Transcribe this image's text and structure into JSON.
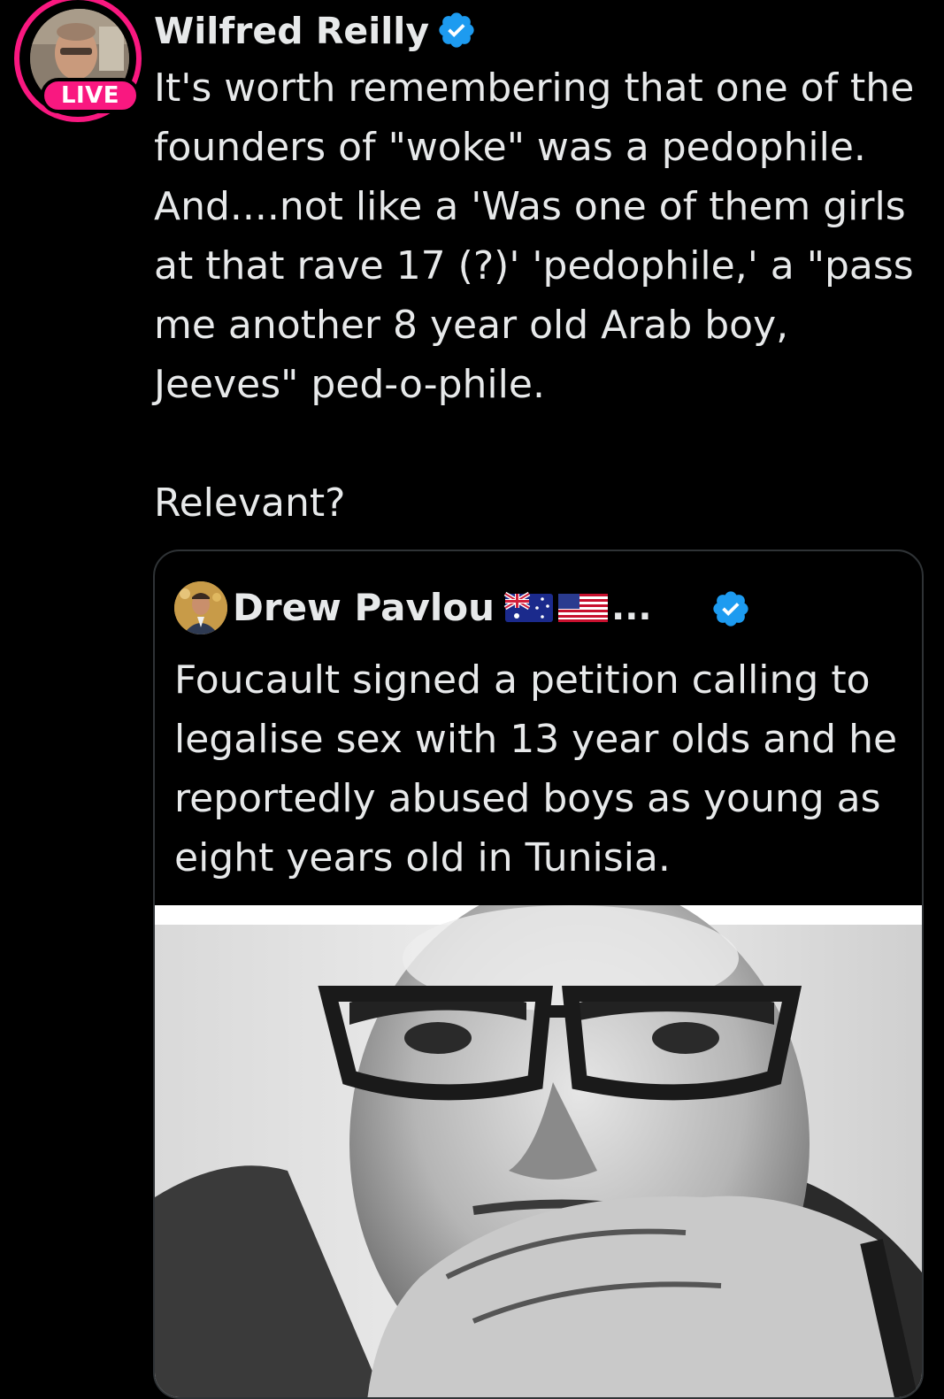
{
  "author": {
    "name": "Wilfred Reilly",
    "live_badge": "LIVE",
    "verified": true,
    "verified_color": "#1d9bf0",
    "live_ring_color": "#f91880"
  },
  "tweet": {
    "lines": [
      "It's worth remembering that one of the",
      "founders of \"woke\" was a pedophile.",
      "And....not like a 'Was one of them girls",
      "at that rave 17 (?)' 'pedophile,' a \"pass",
      "me another 8 year old Arab boy,",
      "Jeeves\" ped-o-phile."
    ],
    "closing_line": "Relevant?"
  },
  "quote": {
    "author_name": "Drew Pavlou",
    "flags": [
      "australia-flag-icon",
      "usa-flag-icon"
    ],
    "name_truncation": "...",
    "verified": true,
    "lines": [
      "Foucault signed a petition calling to",
      "legalise sex with 13 year olds and he",
      "reportedly abused boys as young as",
      "eight years old in Tunisia."
    ],
    "media": "black-and-white-portrait-photo"
  }
}
